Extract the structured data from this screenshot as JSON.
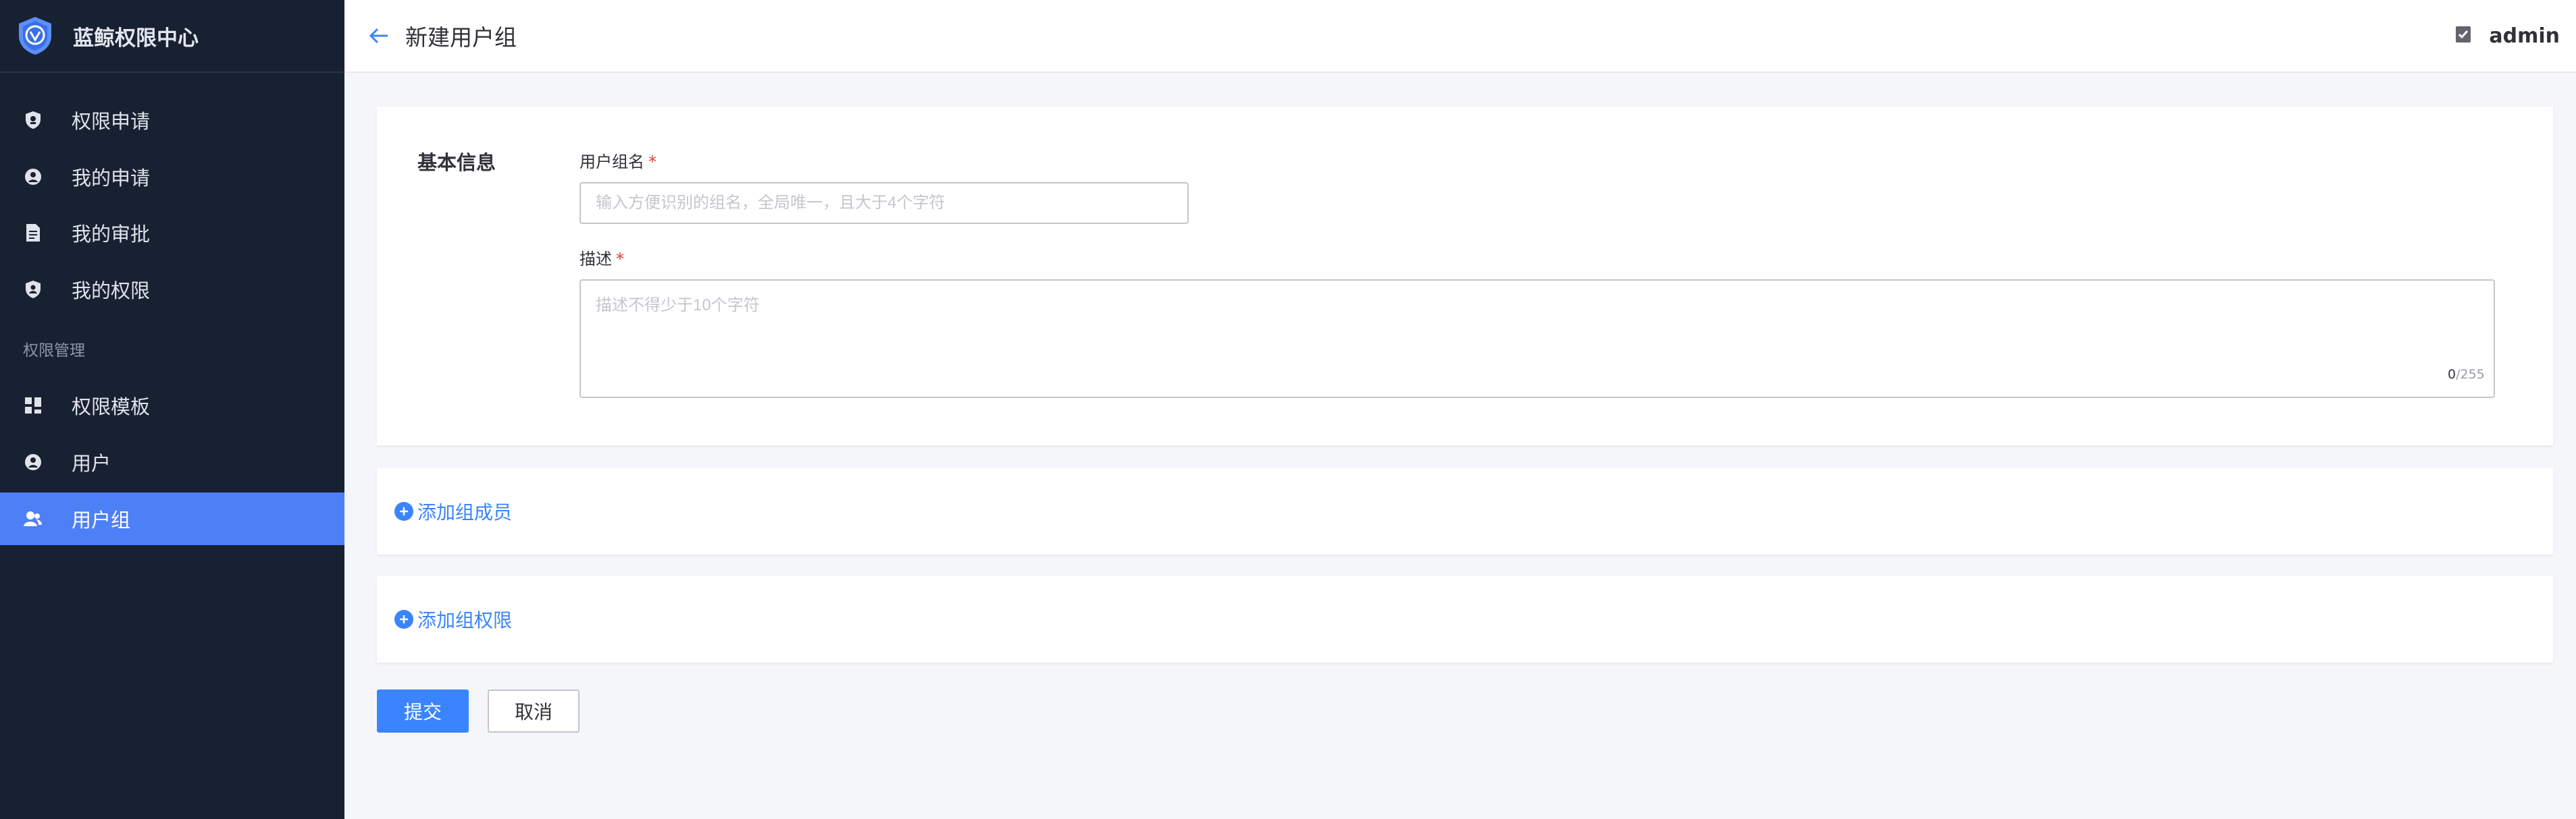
{
  "app": {
    "title": "蓝鲸权限中心"
  },
  "sidebar": {
    "items": [
      {
        "label": "权限申请",
        "icon": "shield-apply-icon"
      },
      {
        "label": "我的申请",
        "icon": "user-circle-icon"
      },
      {
        "label": "我的审批",
        "icon": "document-icon"
      },
      {
        "label": "我的权限",
        "icon": "shield-user-icon"
      }
    ],
    "group_label": "权限管理",
    "manage_items": [
      {
        "label": "权限模板",
        "icon": "grid-icon"
      },
      {
        "label": "用户",
        "icon": "user-circle-icon"
      },
      {
        "label": "用户组",
        "icon": "users-icon",
        "active": true
      }
    ]
  },
  "header": {
    "title": "新建用户组",
    "user": "admin"
  },
  "basic": {
    "section_label": "基本信息",
    "name_label": "用户组名",
    "name_placeholder": "输入方便识别的组名，全局唯一，且大于4个字符",
    "desc_label": "描述",
    "desc_placeholder": "描述不得少于10个字符",
    "counter_current": "0",
    "counter_max": "/255",
    "required_mark": "*"
  },
  "members": {
    "add_label": "添加组成员"
  },
  "perms": {
    "add_label": "添加组权限"
  },
  "actions": {
    "submit": "提交",
    "cancel": "取消"
  },
  "colors": {
    "sidebar_bg": "#182132",
    "accent": "#3a84ff",
    "active_bg": "#4d7ff7"
  }
}
